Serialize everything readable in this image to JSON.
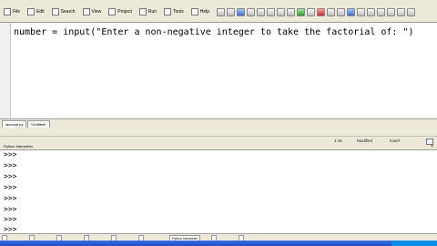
{
  "menu": {
    "items": [
      "File",
      "Edit",
      "Search",
      "View",
      "Project",
      "Run",
      "Tools",
      "Help"
    ]
  },
  "editor": {
    "code": "number = input(\"Enter a non-negative integer to take the factorial of: \")"
  },
  "editor_tabs": [
    "factorial.py",
    "*Untitled*"
  ],
  "status": {
    "position": "1:45",
    "modified": "Modified",
    "encoding": "Insert"
  },
  "shell": {
    "title": "Python Interpreter",
    "prompts": [
      ">>>",
      ">>>",
      ">>>",
      ">>>",
      ">>>",
      ">>>",
      ">>>",
      ">>>",
      ">>>"
    ]
  },
  "bottom_tabs": [
    "Python Interpreter"
  ]
}
